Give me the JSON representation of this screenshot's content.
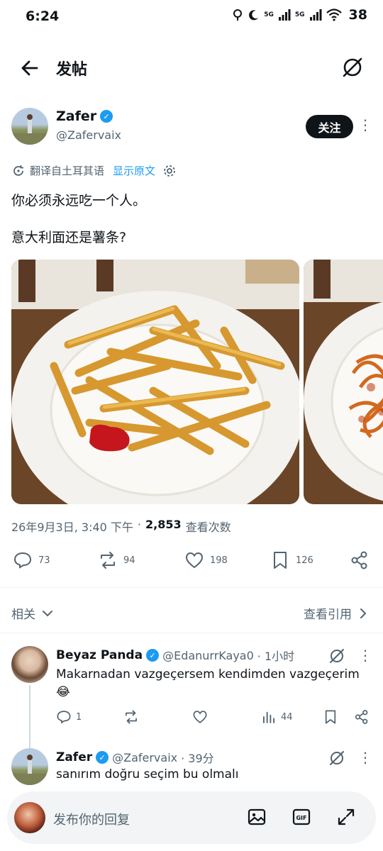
{
  "status_bar": {
    "time": "6:24",
    "network_1": "5G",
    "network_2": "5G",
    "battery": "38"
  },
  "header": {
    "title": "发帖",
    "back_icon": "arrow-left-icon",
    "grok_icon": "grok-icon"
  },
  "tweet": {
    "author_name": "Zafer",
    "author_handle": "@Zafervaix",
    "follow_label": "关注",
    "translate_label": "翻译自土耳其语",
    "show_original_label": "显示原文",
    "text_line_1": "你必须永远吃一个人。",
    "text_line_2": "意大利面还是薯条?",
    "media": [
      "french-fries-plate",
      "spaghetti-plate"
    ],
    "date": "26年9月3日, 3:40 下午",
    "separator": "·",
    "views_count": "2,853",
    "views_label": "查看次数",
    "stats": {
      "replies": "73",
      "retweets": "94",
      "likes": "198",
      "bookmarks": "126"
    }
  },
  "related": {
    "label": "相关",
    "view_quotes": "查看引用"
  },
  "replies": [
    {
      "name": "Beyaz Panda",
      "handle": "@EdanurrKaya0",
      "time": "· 1小时",
      "text": "Makarnadan vazgeçersem kendimden vazgeçerim 😂",
      "stats": {
        "replies": "1",
        "views": "44"
      }
    },
    {
      "name": "Zafer",
      "handle": "@Zafervaix",
      "time": "· 39分",
      "text": "sanırım doğru seçim bu olmalı"
    }
  ],
  "compose": {
    "placeholder": "发布你的回复"
  },
  "colors": {
    "accent": "#1d9bf0",
    "text": "#0f1419",
    "secondary": "#536471",
    "ketchup": "#c4161c"
  }
}
